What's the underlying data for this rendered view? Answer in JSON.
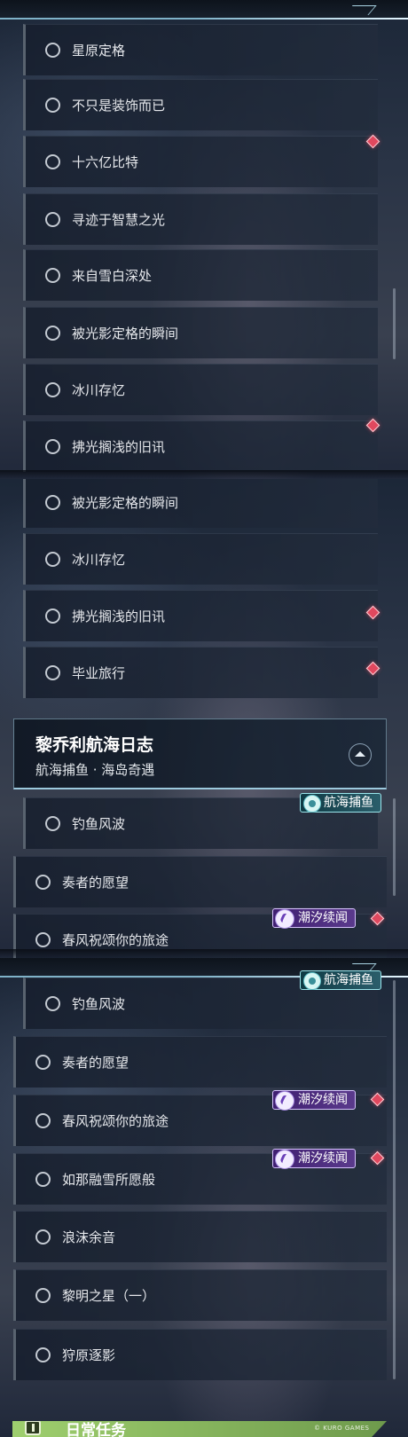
{
  "panel1": {
    "items": [
      {
        "label": "星原定格",
        "alert": false
      },
      {
        "label": "不只是装饰而已",
        "alert": false
      },
      {
        "label": "十六亿比特",
        "alert": true
      },
      {
        "label": "寻迹于智慧之光",
        "alert": false
      },
      {
        "label": "来自雪白深处",
        "alert": false
      },
      {
        "label": "被光影定格的瞬间",
        "alert": false
      },
      {
        "label": "冰川存忆",
        "alert": false
      },
      {
        "label": "拂光搁浅的旧讯",
        "alert": true
      }
    ]
  },
  "panel2": {
    "items": [
      {
        "label": "被光影定格的瞬间"
      },
      {
        "label": "冰川存忆"
      },
      {
        "label": "拂光搁浅的旧讯"
      },
      {
        "label": "毕业旅行"
      }
    ],
    "section": {
      "title": "黎乔利航海日志",
      "subtitle": "航海捕鱼 · 海岛奇遇"
    },
    "sub_items": [
      {
        "label": "钓鱼风波",
        "tag": "航海捕鱼"
      },
      {
        "label": "奏者的愿望"
      },
      {
        "label": "春风祝颂你的旅途",
        "tag": "潮汐续闻"
      }
    ]
  },
  "panel3": {
    "items": [
      {
        "label": "钓鱼风波",
        "tag": "航海捕鱼"
      },
      {
        "label": "奏者的愿望"
      },
      {
        "label": "春风祝颂你的旅途",
        "tag": "潮汐续闻"
      },
      {
        "label": "如那融雪所愿般",
        "tag": "潮汐续闻"
      },
      {
        "label": "浪沫余音"
      },
      {
        "label": "黎明之星（一）"
      },
      {
        "label": "狩原逐影"
      }
    ],
    "daily_label": "日常任务",
    "watermark": "© KURO GAMES"
  },
  "colors": {
    "alert": "#e0485e",
    "tag_cyan": "#2b5e6b",
    "tag_purple": "#5a3a8c",
    "daily_bar": "#9fcf6e"
  }
}
